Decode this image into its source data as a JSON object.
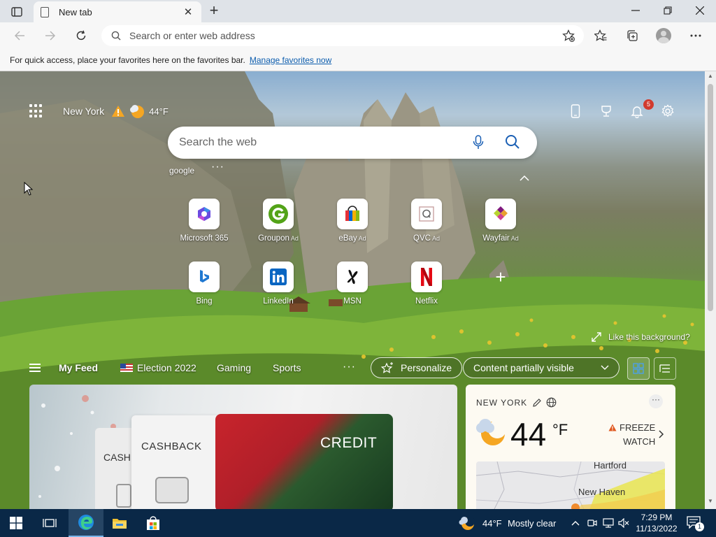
{
  "browser": {
    "tab_title": "New tab",
    "address_placeholder": "Search or enter web address",
    "favorites_bar_text": "For quick access, place your favorites here on the favorites bar.",
    "manage_favorites_link": "Manage favorites now"
  },
  "ntp": {
    "city": "New York",
    "temperature": "44°F",
    "notification_count": "5",
    "search_placeholder": "Search the web",
    "recent_search": "google",
    "quick_links": [
      {
        "label": "Microsoft 365",
        "ad": ""
      },
      {
        "label": "Groupon",
        "ad": "Ad"
      },
      {
        "label": "eBay",
        "ad": "Ad"
      },
      {
        "label": "QVC",
        "ad": "Ad"
      },
      {
        "label": "Wayfair",
        "ad": "Ad"
      },
      {
        "label": "Bing",
        "ad": ""
      },
      {
        "label": "LinkedIn",
        "ad": ""
      },
      {
        "label": "MSN",
        "ad": ""
      },
      {
        "label": "Netflix",
        "ad": ""
      }
    ],
    "like_background": "Like this background?",
    "feed_tabs": [
      "My Feed",
      "Election 2022",
      "Gaming",
      "Sports"
    ],
    "personalize_label": "Personalize",
    "content_visibility": "Content partially visible",
    "card": {
      "credit_text": "CREDIT",
      "cashback_text": "CASHBACK",
      "cash_text": "CASH"
    },
    "weather_card": {
      "city": "NEW YORK",
      "temp": "44",
      "unit": "°F",
      "alert_line1": "FREEZE",
      "alert_line2": "WATCH",
      "map_label_1": "Hartford",
      "map_label_2": "New Haven"
    }
  },
  "taskbar": {
    "weather_temp": "44°F",
    "weather_desc": "Mostly clear",
    "time": "7:29 PM",
    "date": "11/13/2022",
    "notification_count": "1"
  },
  "colors": {
    "accent": "#0b5cad",
    "taskbar": "#0a2847",
    "alert": "#d13b2e"
  }
}
